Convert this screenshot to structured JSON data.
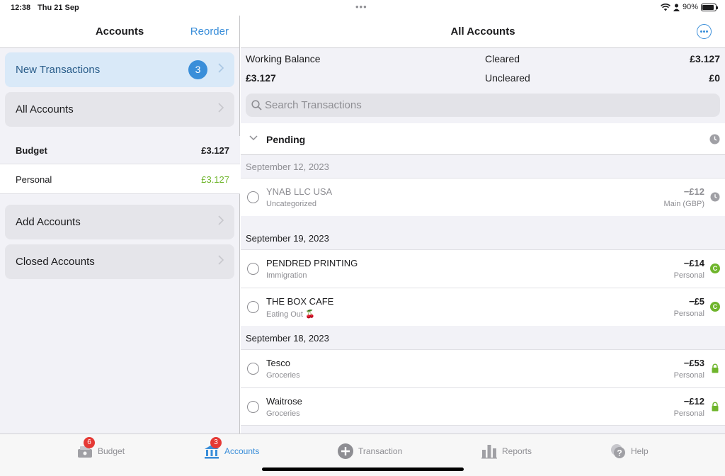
{
  "status_bar": {
    "time": "12:38",
    "date": "Thu 21 Sep",
    "battery": "90%",
    "battery_level": 0.9
  },
  "left": {
    "title": "Accounts",
    "reorder_label": "Reorder",
    "new_transactions": {
      "label": "New Transactions",
      "count": "3"
    },
    "all_accounts_label": "All Accounts",
    "budget": {
      "label": "Budget",
      "total": "£3.127"
    },
    "accounts": [
      {
        "name": "Personal",
        "balance": "£3.127"
      }
    ],
    "add_accounts_label": "Add Accounts",
    "closed_accounts_label": "Closed Accounts"
  },
  "right": {
    "title": "All Accounts",
    "balances": {
      "working_label": "Working Balance",
      "working_value": "£3.127",
      "cleared_label": "Cleared",
      "cleared_value": "£3.127",
      "uncleared_label": "Uncleared",
      "uncleared_value": "£0"
    },
    "search_placeholder": "Search Transactions",
    "pending_label": "Pending",
    "groups": [
      {
        "date": "September 12, 2023",
        "transactions": [
          {
            "payee": "YNAB LLC USA",
            "category": "Uncategorized",
            "amount": "−£12",
            "account": "Main (GBP)",
            "status": "pending"
          }
        ]
      },
      {
        "date": "September 19, 2023",
        "transactions": [
          {
            "payee": "PENDRED PRINTING",
            "category": "Immigration",
            "amount": "−£14",
            "account": "Personal",
            "status": "cleared"
          },
          {
            "payee": "THE BOX CAFE",
            "category": "Eating Out 🍒",
            "amount": "−£5",
            "account": "Personal",
            "status": "cleared"
          }
        ]
      },
      {
        "date": "September 18, 2023",
        "transactions": [
          {
            "payee": "Tesco",
            "category": "Groceries",
            "amount": "−£53",
            "account": "Personal",
            "status": "reconciled"
          },
          {
            "payee": "Waitrose",
            "category": "Groceries",
            "amount": "−£12",
            "account": "Personal",
            "status": "reconciled"
          }
        ]
      }
    ]
  },
  "tabbar": {
    "tabs": [
      {
        "label": "Budget",
        "icon": "budget-icon",
        "badge": "6"
      },
      {
        "label": "Accounts",
        "icon": "bank-icon",
        "badge": "3"
      },
      {
        "label": "Transaction",
        "icon": "plus-circle-icon"
      },
      {
        "label": "Reports",
        "icon": "bar-chart-icon"
      },
      {
        "label": "Help",
        "icon": "help-icon"
      }
    ]
  },
  "colors": {
    "accent": "#3a8ed9",
    "positive": "#6fb52c",
    "badge_red": "#e53935"
  }
}
